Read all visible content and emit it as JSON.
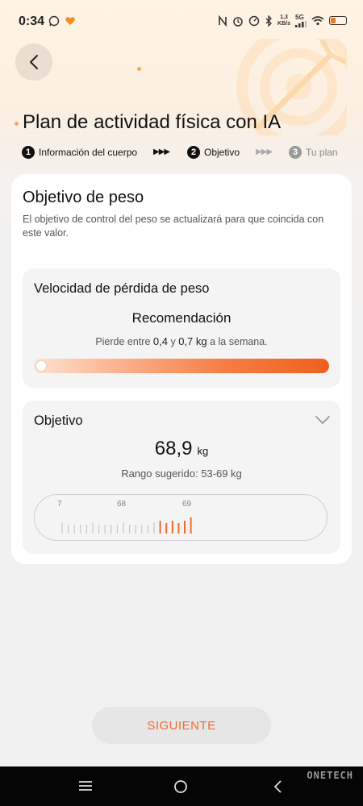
{
  "status_bar": {
    "time": "0:34",
    "net_speed_top": "1,3",
    "net_speed_unit": "KB/s",
    "network": "5G",
    "left_icons": [
      "whatsapp-icon",
      "heart-app-icon"
    ],
    "right_icons": [
      "nfc-icon",
      "alarm-icon",
      "speedometer-icon",
      "bluetooth-icon",
      "signal-icon",
      "wifi-icon",
      "battery-icon"
    ]
  },
  "header": {
    "title": "Plan de actividad física con IA"
  },
  "steps": [
    {
      "number": "1",
      "label": "Información del cuerpo",
      "state": "done"
    },
    {
      "number": "2",
      "label": "Objetivo",
      "state": "current"
    },
    {
      "number": "3",
      "label": "Tu plan",
      "state": "pending"
    }
  ],
  "weight_goal": {
    "title": "Objetivo de peso",
    "description": "El objetivo de control del peso se actualizará para que coincida con este valor."
  },
  "speed": {
    "title": "Velocidad de pérdida de peso",
    "recommendation_title": "Recomendación",
    "rec_prefix": "Pierde entre",
    "rec_min": "0,4",
    "rec_mid": "y",
    "rec_max": "0,7 kg",
    "rec_suffix": "a la semana.",
    "slider_level": 0
  },
  "goal": {
    "title": "Objetivo",
    "value": "68,9",
    "unit": "kg",
    "range_text": "Rango sugerido: 53-69 kg",
    "ruler_labels": [
      "7",
      "68",
      "69"
    ]
  },
  "footer": {
    "next_label": "SIGUIENTE"
  },
  "navbar": {
    "watermark": "ONETECH"
  },
  "colors": {
    "accent": "#f26a2c",
    "slider_start": "#fde2d2",
    "slider_end": "#ef5f1e"
  }
}
